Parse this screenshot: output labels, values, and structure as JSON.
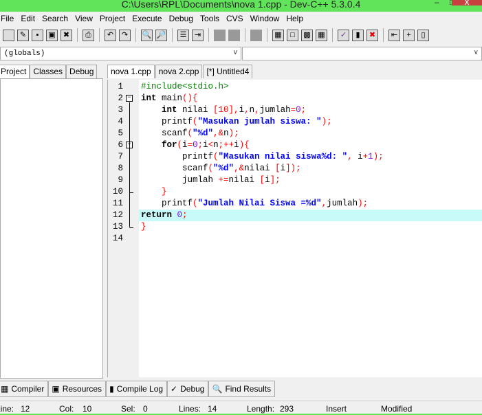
{
  "window": {
    "title": "C:\\Users\\RPL\\Documents\\nova 1.cpp - Dev-C++ 5.3.0.4",
    "close": "x"
  },
  "menu": [
    "File",
    "Edit",
    "Search",
    "View",
    "Project",
    "Execute",
    "Debug",
    "Tools",
    "CVS",
    "Window",
    "Help"
  ],
  "toolbar_icons": [
    "new",
    "open",
    "save",
    "save-all",
    "close",
    "print",
    "undo",
    "redo",
    "find",
    "replace",
    "toggle-bookmark",
    "goto",
    "compile-run-disabled1",
    "compile-run-disabled2",
    "stop-disabled",
    "compile",
    "run",
    "compile-run",
    "rebuild",
    "check-syntax",
    "chart",
    "delete",
    "indent",
    "add",
    "exit"
  ],
  "combos": {
    "scope": "(globals)",
    "members": ""
  },
  "left_tabs": [
    "Project",
    "Classes",
    "Debug"
  ],
  "editor_tabs": [
    "nova 1.cpp",
    "nova 2.cpp",
    "[*] Untitled4"
  ],
  "code": [
    [
      [
        "pp",
        "#include<stdio.h>"
      ]
    ],
    [
      [
        "kw",
        "int "
      ],
      [
        "id",
        "main"
      ],
      [
        "sym",
        "(){"
      ]
    ],
    [
      [
        "id",
        "    "
      ],
      [
        "kw",
        "int "
      ],
      [
        "id",
        "nilai "
      ],
      [
        "sym",
        "[10],"
      ],
      [
        "id",
        "i"
      ],
      [
        "sym",
        ","
      ],
      [
        "id",
        "n"
      ],
      [
        "sym",
        ","
      ],
      [
        "id",
        "jumlah"
      ],
      [
        "sym",
        "="
      ],
      [
        "num",
        "0"
      ],
      [
        "sym",
        ";"
      ]
    ],
    [
      [
        "id",
        "    printf"
      ],
      [
        "sym",
        "("
      ],
      [
        "str",
        "\"Masukan jumlah siswa: \""
      ],
      [
        "sym",
        ");"
      ]
    ],
    [
      [
        "id",
        "    scanf"
      ],
      [
        "sym",
        "("
      ],
      [
        "str",
        "\"%d\""
      ],
      [
        "sym",
        ",&"
      ],
      [
        "id",
        "n"
      ],
      [
        "sym",
        ");"
      ]
    ],
    [
      [
        "id",
        "    "
      ],
      [
        "kw",
        "for"
      ],
      [
        "sym",
        "("
      ],
      [
        "id",
        "i"
      ],
      [
        "sym",
        "="
      ],
      [
        "num",
        "0"
      ],
      [
        "sym",
        ";"
      ],
      [
        "id",
        "i"
      ],
      [
        "sym",
        "<"
      ],
      [
        "id",
        "n"
      ],
      [
        "sym",
        ";++"
      ],
      [
        "id",
        "i"
      ],
      [
        "sym",
        "){"
      ]
    ],
    [
      [
        "id",
        "        printf"
      ],
      [
        "sym",
        "("
      ],
      [
        "str",
        "\"Masukan nilai siswa%d: \""
      ],
      [
        "sym",
        ", "
      ],
      [
        "id",
        "i"
      ],
      [
        "sym",
        "+"
      ],
      [
        "num",
        "1"
      ],
      [
        "sym",
        ");"
      ]
    ],
    [
      [
        "id",
        "        scanf"
      ],
      [
        "sym",
        "("
      ],
      [
        "str",
        "\"%d\""
      ],
      [
        "sym",
        ",&"
      ],
      [
        "id",
        "nilai "
      ],
      [
        "sym",
        "["
      ],
      [
        "id",
        "i"
      ],
      [
        "sym",
        "]);"
      ]
    ],
    [
      [
        "id",
        "        jumlah "
      ],
      [
        "sym",
        "+="
      ],
      [
        "id",
        "nilai "
      ],
      [
        "sym",
        "["
      ],
      [
        "id",
        "i"
      ],
      [
        "sym",
        "];"
      ]
    ],
    [
      [
        "id",
        "    "
      ],
      [
        "sym",
        "}"
      ]
    ],
    [
      [
        "id",
        "    printf"
      ],
      [
        "sym",
        "("
      ],
      [
        "str",
        "\"Jumlah Nilai Siswa =%d\""
      ],
      [
        "sym",
        ","
      ],
      [
        "id",
        "jumlah"
      ],
      [
        "sym",
        ");"
      ]
    ],
    [
      [
        "kw",
        "return "
      ],
      [
        "num",
        "0"
      ],
      [
        "sym",
        ";"
      ]
    ],
    [
      [
        "sym",
        "}"
      ]
    ],
    []
  ],
  "current_line": 12,
  "bottom_tabs": [
    {
      "label": "Compiler",
      "icon": "compiler-icon"
    },
    {
      "label": "Resources",
      "icon": "resources-icon"
    },
    {
      "label": "Compile Log",
      "icon": "chart-icon"
    },
    {
      "label": "Debug",
      "icon": "check-icon"
    },
    {
      "label": "Find Results",
      "icon": "find-icon"
    }
  ],
  "status": {
    "line_label": "Line:",
    "line": "12",
    "col_label": "Col:",
    "col": "10",
    "sel_label": "Sel:",
    "sel": "0",
    "lines_label": "Lines:",
    "lines": "14",
    "length_label": "Length:",
    "length": "293",
    "mode": "Insert",
    "modified": "Modified"
  }
}
